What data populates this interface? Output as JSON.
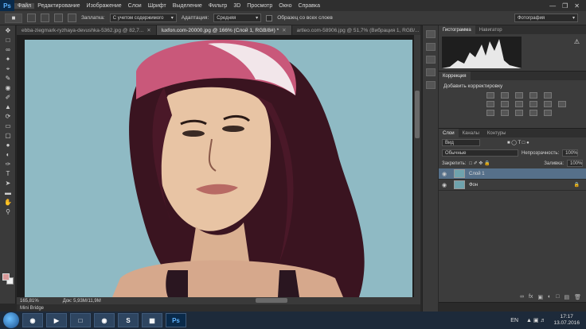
{
  "app": {
    "logo": "Ps"
  },
  "menu": [
    "Файл",
    "Редактирование",
    "Изображение",
    "Слои",
    "Шрифт",
    "Выделение",
    "Фильтр",
    "3D",
    "Просмотр",
    "Окно",
    "Справка"
  ],
  "window_controls": [
    "minimize-icon",
    "restore-icon",
    "close-icon"
  ],
  "options": {
    "fill_label": "Заплатка:",
    "fill_value": "С учетом содержимого",
    "adapt_label": "Адаптация:",
    "adapt_value": "Средняя",
    "sample_label": "Образец со всех слоев",
    "workspace": "Фотография"
  },
  "tabs": [
    {
      "label": "ebba-ziegmark-ryzhaya-devushka-5362.jpg @ 82,7...",
      "active": false
    },
    {
      "label": "luxfon.com-20000.jpg @ 166% (Слой 1, RGB/8#) *",
      "active": true
    },
    {
      "label": "artleo.com-58906.jpg @ 51,7% (Вибрация 1, RGB/...",
      "active": false
    }
  ],
  "status": {
    "zoom": "165,81%",
    "doc": "Док: 5,93M/11,9M"
  },
  "mini_bridge": "Mini Bridge",
  "panels": {
    "histogram_tabs": [
      "Гистограмма",
      "Навигатор"
    ],
    "adjust_tab": "Коррекция",
    "adjust_title": "Добавить корректировку",
    "layers_tabs": [
      "Слои",
      "Каналы",
      "Контуры"
    ],
    "kind_label": "Вид",
    "blend_mode": "Обычные",
    "opacity_label": "Непрозрачность:",
    "opacity_value": "100%",
    "lock_label": "Закрепить:",
    "fill_label": "Заливка:",
    "fill_value": "100%",
    "layers": [
      {
        "name": "Слой 1",
        "selected": true
      },
      {
        "name": "Фон",
        "selected": false
      }
    ]
  },
  "taskbar": {
    "lang": "EN",
    "time": "17:17",
    "date": "13.07.2016",
    "ps_label": "Ps"
  }
}
